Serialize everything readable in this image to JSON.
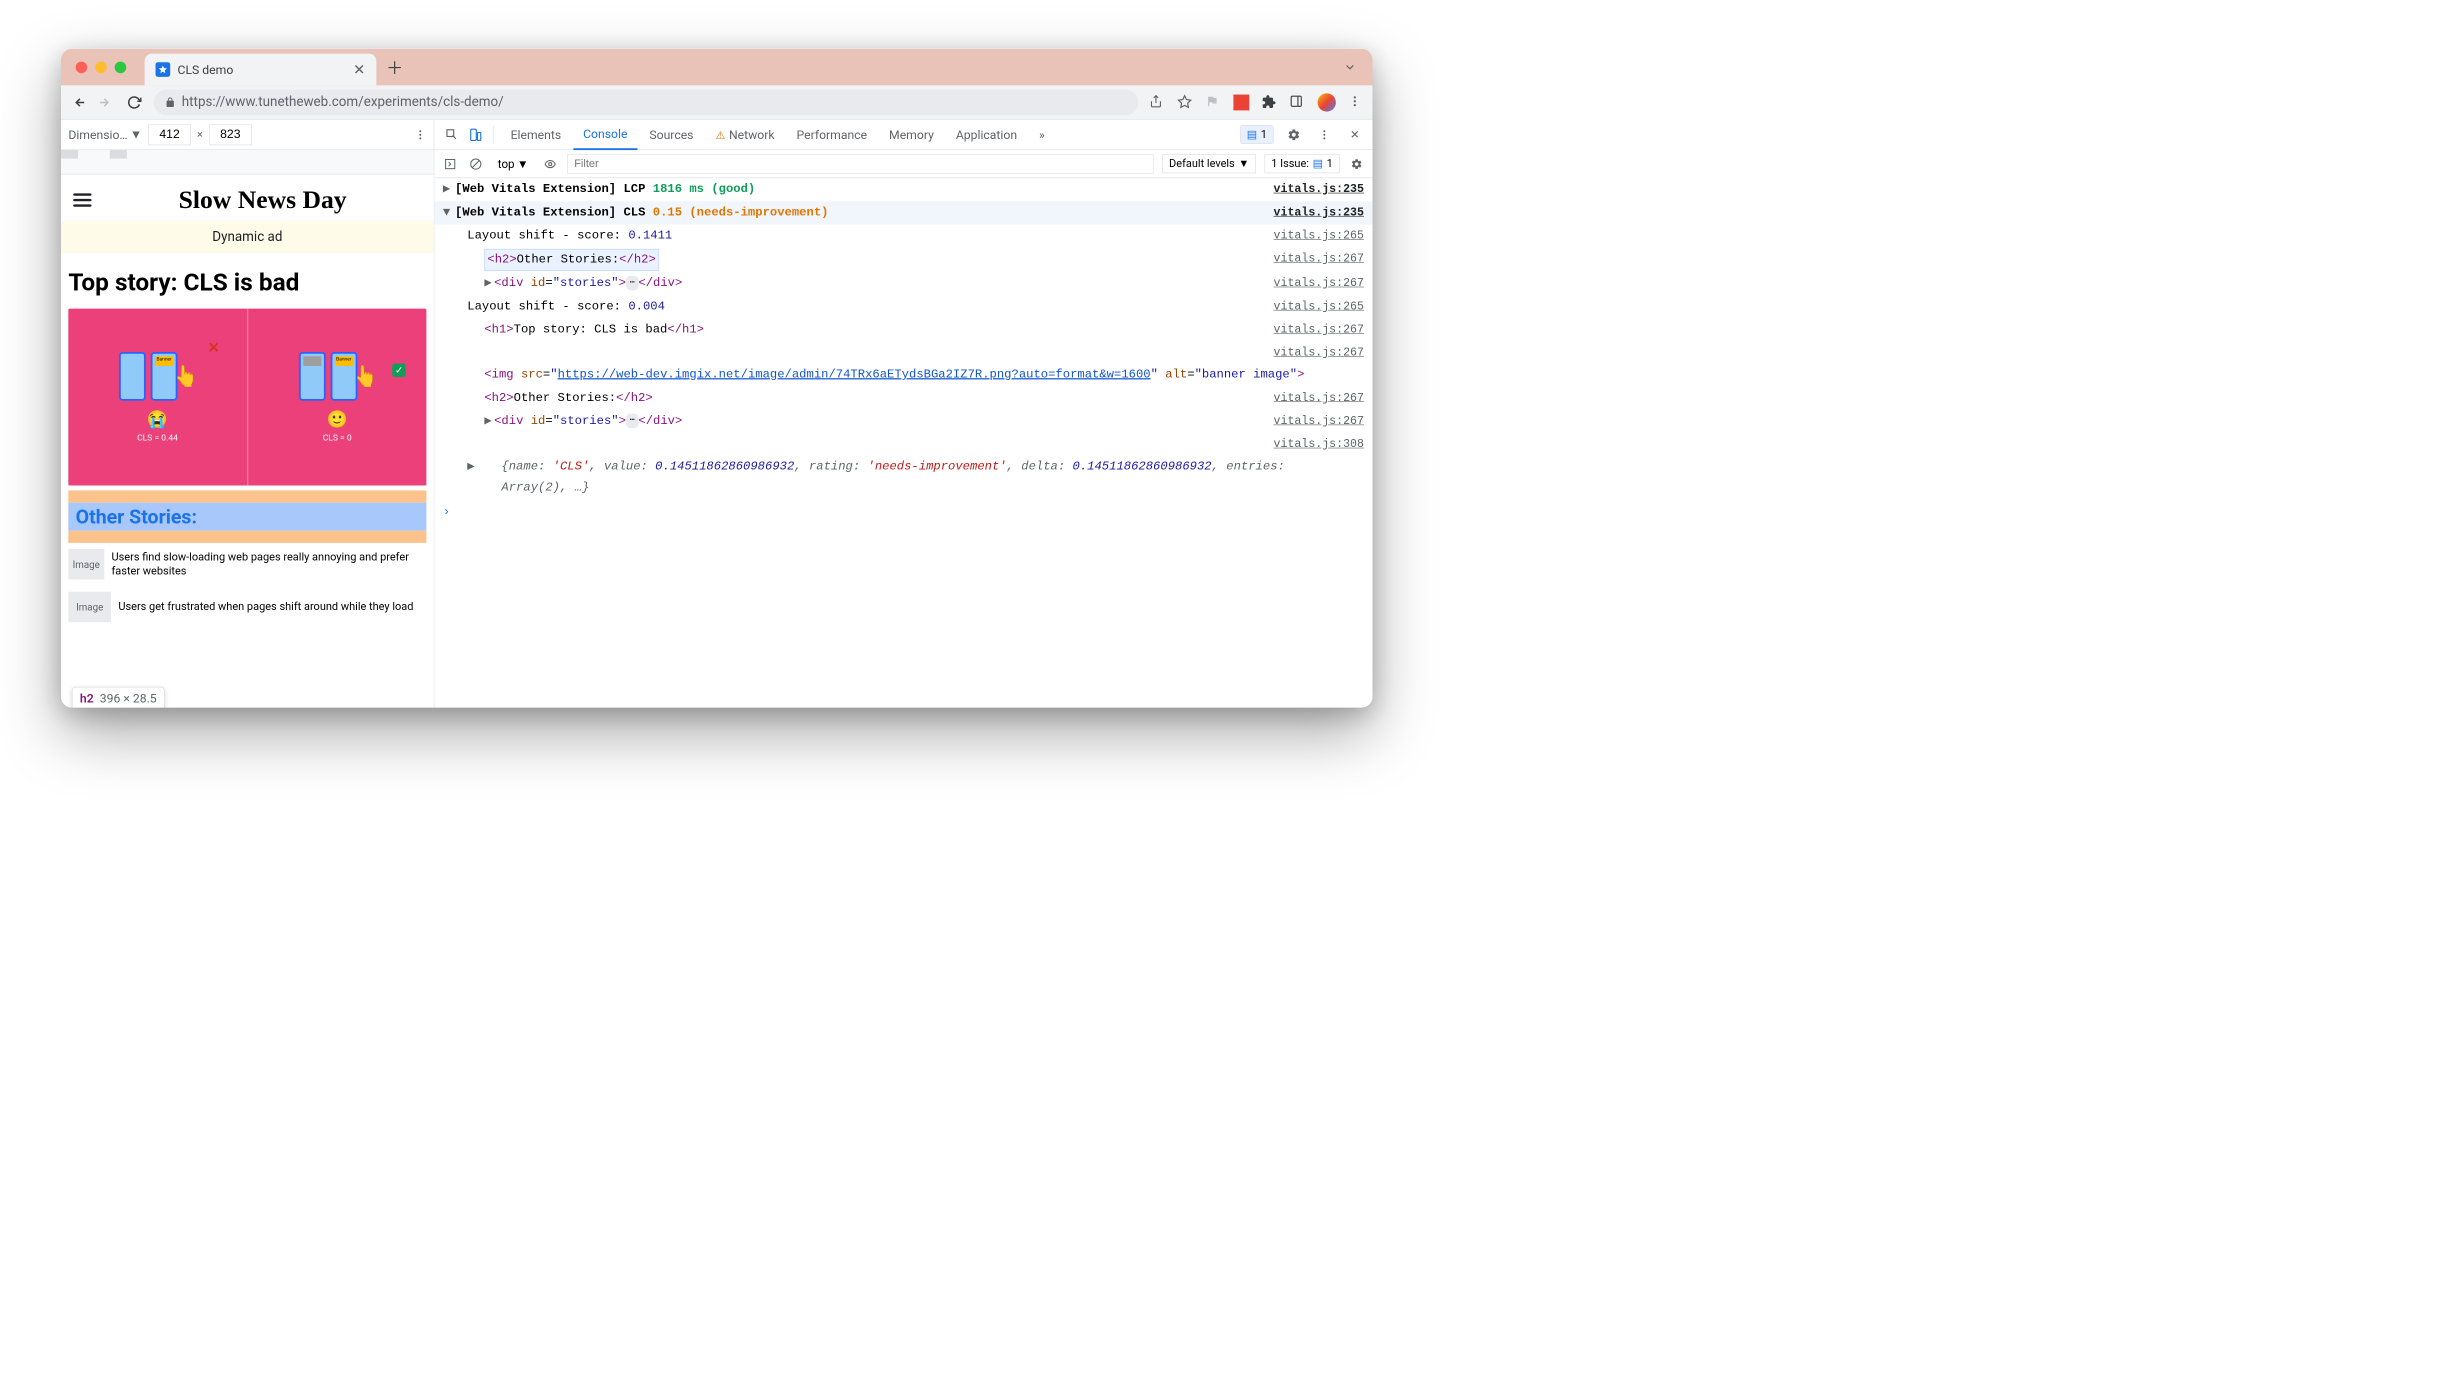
{
  "window": {
    "tab_title": "CLS demo",
    "url": "https://www.tunetheweb.com/experiments/cls-demo/"
  },
  "device_toolbar": {
    "dimensions_label": "Dimensio…",
    "width": "412",
    "height": "823"
  },
  "page": {
    "site_title": "Slow News Day",
    "ad_text": "Dynamic ad",
    "top_story": "Top story: CLS is bad",
    "banner": {
      "left_cls": "CLS = 0.44",
      "right_cls": "CLS = 0"
    },
    "inspect_tooltip": {
      "tag": "h2",
      "dims": "396 × 28.5"
    },
    "other_stories_heading": "Other Stories:",
    "stories": [
      {
        "thumb": "Image",
        "text": "Users find slow-loading web pages really annoying and prefer faster websites"
      },
      {
        "thumb": "Image",
        "text": "Users get frustrated when pages shift around while they load"
      }
    ]
  },
  "devtools": {
    "tabs": [
      "Elements",
      "Console",
      "Sources",
      "Network",
      "Performance",
      "Memory",
      "Application"
    ],
    "active_tab": "Console",
    "warn_tab": "Network",
    "more_tabs": "»",
    "badge_count": "1",
    "issues_label": "1 Issue:",
    "issues_count": "1",
    "console_toolbar": {
      "context": "top",
      "filter_placeholder": "Filter",
      "levels": "Default levels"
    },
    "logs": [
      {
        "type": "collapsed",
        "prefix": "[Web Vitals Extension] LCP",
        "value": "1816 ms",
        "rating_class": "good",
        "rating": "(good)",
        "source": "vitals.js:235",
        "source_bold": true
      },
      {
        "type": "expanded",
        "prefix": "[Web Vitals Extension] CLS",
        "value": "0.15",
        "rating_class": "warn-text",
        "rating": "(needs-improvement)",
        "source": "vitals.js:235",
        "source_bold": true,
        "children": [
          {
            "type": "text",
            "indent": 1,
            "text_parts": [
              {
                "t": "Layout shift - score:  "
              },
              {
                "t": "0.1411",
                "cls": "num"
              }
            ],
            "source": "vitals.js:265"
          },
          {
            "type": "html-highlight",
            "indent": 2,
            "html_inner": "h2",
            "content": "Other Stories:",
            "source": "vitals.js:267"
          },
          {
            "type": "html-collapsed",
            "indent": 2,
            "arrow": true,
            "tag": "div",
            "attrs": [
              {
                "n": "id",
                "v": "stories"
              }
            ],
            "source": "vitals.js:267"
          },
          {
            "type": "text",
            "indent": 1,
            "text_parts": [
              {
                "t": "Layout shift - score:  "
              },
              {
                "t": "0.004",
                "cls": "num"
              }
            ],
            "source": "vitals.js:265"
          },
          {
            "type": "html-plain",
            "indent": 2,
            "tag": "h1",
            "content": "Top story: CLS is bad",
            "source": "vitals.js:267"
          },
          {
            "type": "source-only",
            "source": "vitals.js:267"
          },
          {
            "type": "img-tag",
            "indent": 2,
            "src": "https://web-dev.imgix.net/image/admin/74TRx6aETydsBGa2IZ7R.png?auto=format&w=1600",
            "alt_partial": "banner image"
          },
          {
            "type": "html-plain",
            "indent": 2,
            "tag": "h2",
            "content": "Other Stories:",
            "source": "vitals.js:267"
          },
          {
            "type": "html-collapsed",
            "indent": 2,
            "arrow": true,
            "tag": "div",
            "attrs": [
              {
                "n": "id",
                "v": "stories"
              }
            ],
            "source": "vitals.js:267"
          },
          {
            "type": "source-only",
            "source": "vitals.js:308"
          },
          {
            "type": "object",
            "indent": 1,
            "repr": "{name: 'CLS', value: 0.14511862860986932, rating: 'needs-improvement', delta: 0.14511862860986932, entries: Array(2), …}"
          }
        ]
      }
    ]
  }
}
